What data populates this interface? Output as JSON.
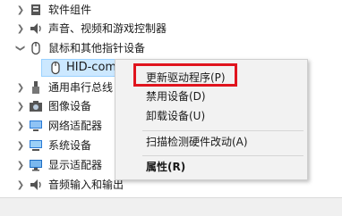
{
  "tree": {
    "items": [
      {
        "label": "软件组件",
        "icon": "software-component-icon",
        "expanded": false
      },
      {
        "label": "声音、视频和游戏控制器",
        "icon": "speaker-icon",
        "expanded": false
      },
      {
        "label": "鼠标和其他指针设备",
        "icon": "mouse-icon",
        "expanded": true
      },
      {
        "label": "HID-com",
        "icon": "mouse-icon",
        "child": true
      },
      {
        "label": "通用串行总线",
        "icon": "usb-icon",
        "expanded": false
      },
      {
        "label": "图像设备",
        "icon": "camera-icon",
        "expanded": false
      },
      {
        "label": "网络适配器",
        "icon": "network-adapter-icon",
        "expanded": false
      },
      {
        "label": "系统设备",
        "icon": "system-device-icon",
        "expanded": false
      },
      {
        "label": "显示适配器",
        "icon": "display-adapter-icon",
        "expanded": false
      },
      {
        "label": "音频输入和输出",
        "icon": "speaker-icon",
        "expanded": false
      }
    ]
  },
  "context_menu": {
    "update_driver": "更新驱动程序(P)",
    "disable_device": "禁用设备(D)",
    "uninstall_device": "卸载设备(U)",
    "scan_hardware": "扫描检测硬件改动(A)",
    "properties": "属性(R)"
  },
  "colors": {
    "highlight_border": "#e0141e",
    "selection": "#cce8ff"
  }
}
